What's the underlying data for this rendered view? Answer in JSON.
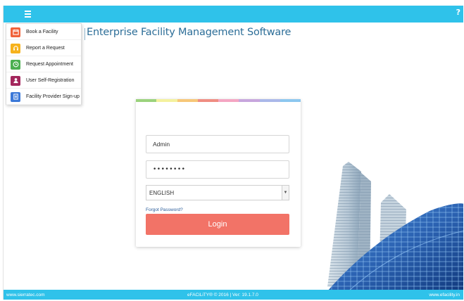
{
  "header": {
    "menu_icon": "hamburger-icon",
    "help_label": "?"
  },
  "menu": {
    "items": [
      {
        "label": "Book a Facility",
        "icon": "calendar-icon",
        "color": "#f0623a"
      },
      {
        "label": "Report a Request",
        "icon": "headset-icon",
        "color": "#f6b21c"
      },
      {
        "label": "Request Appointment",
        "icon": "clock-icon",
        "color": "#4caf50"
      },
      {
        "label": "User Self-Registration",
        "icon": "user-icon",
        "color": "#a3265c"
      },
      {
        "label": "Facility Provider Sign-up",
        "icon": "document-icon",
        "color": "#3b78d8"
      }
    ]
  },
  "app": {
    "title": "Enterprise Facility Management Software"
  },
  "login": {
    "username_value": "Admin",
    "password_value": "••••••••",
    "language_value": "ENGLISH",
    "forgot_label": "Forgot Password?",
    "login_label": "Login",
    "strip_colors": [
      "#9bd27d",
      "#f4f19e",
      "#f7c778",
      "#ef8d82",
      "#f4a6c3",
      "#c7a6dd",
      "#aab8e9",
      "#8cc7ef"
    ]
  },
  "colors": {
    "accent": "#2fc2ea",
    "login_button": "#f27367",
    "title": "#2d6e98"
  },
  "footer": {
    "left": "www.sierratec.com",
    "center": "eFACiLiTY® © 2016 | Ver: 19.1.7.0",
    "right": "www.efacility.in"
  }
}
